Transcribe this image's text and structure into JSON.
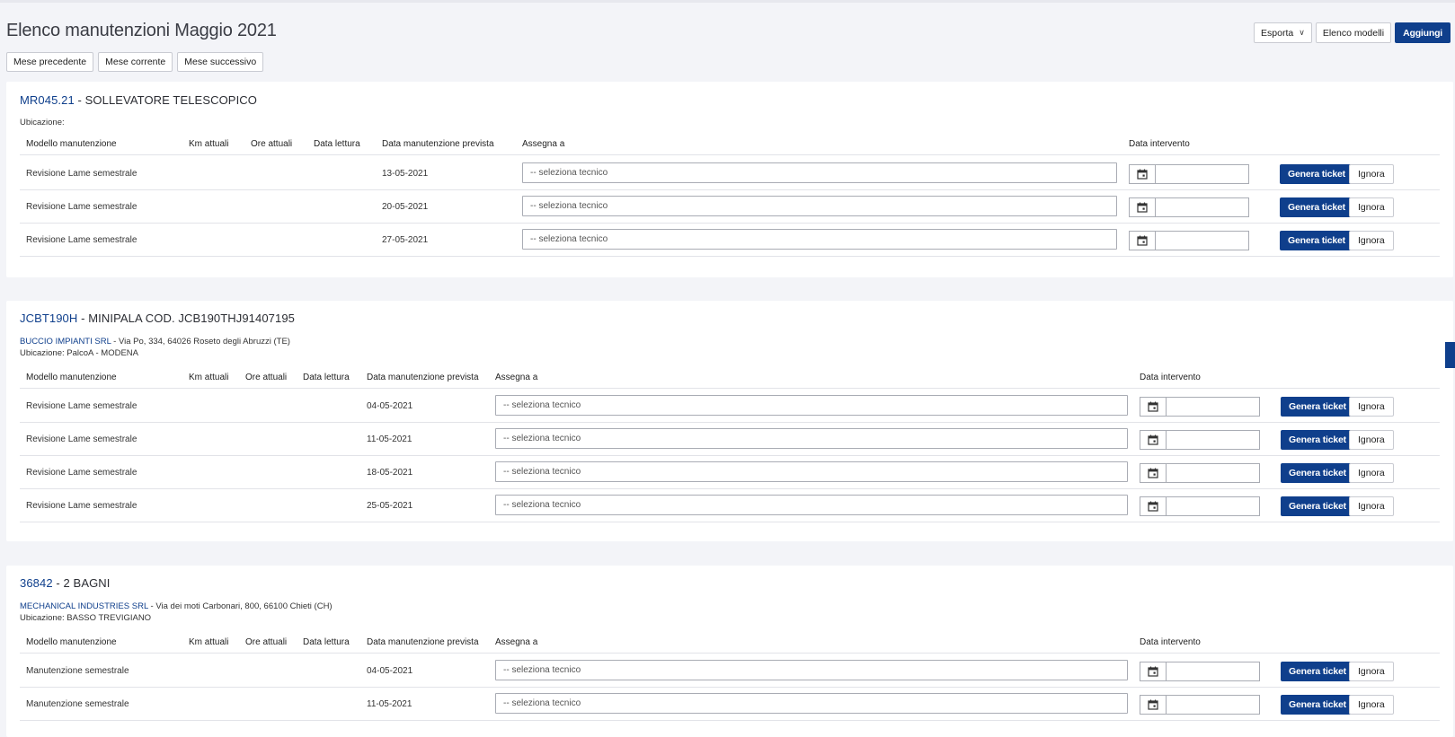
{
  "page": {
    "title": "Elenco manutenzioni Maggio 2021",
    "month_nav": [
      "Mese precedente",
      "Mese corrente",
      "Mese successivo"
    ],
    "actions": {
      "export": "Esporta",
      "models": "Elenco modelli",
      "add": "Aggiungi"
    }
  },
  "columns": {
    "model": "Modello manutenzione",
    "km": "Km attuali",
    "hours": "Ore attuali",
    "reading_date": "Data lettura",
    "planned_date": "Data manutenzione prevista",
    "assign": "Assegna a",
    "intervention_date": "Data intervento"
  },
  "row_labels": {
    "select_placeholder": "-- seleziona tecnico",
    "generate": "Genera ticket",
    "ignore": "Ignora"
  },
  "cards": [
    {
      "code": "MR045.21",
      "sep": " - ",
      "description": "SOLLEVATORE TELESCOPICO",
      "customer": "",
      "address": "",
      "location": "Ubicazione:",
      "rows": [
        {
          "model": "Revisione Lame semestrale",
          "date": "13-05-2021"
        },
        {
          "model": "Revisione Lame semestrale",
          "date": "20-05-2021"
        },
        {
          "model": "Revisione Lame semestrale",
          "date": "27-05-2021"
        }
      ]
    },
    {
      "code": "JCBT190H",
      "sep": " - ",
      "description": "MINIPALA COD. JCB190THJ91407195",
      "customer": "BUCCIO IMPIANTI SRL",
      "address": " - Via Po, 334, 64026 Roseto degli Abruzzi (TE)",
      "location": "Ubicazione: PalcoA - MODENA",
      "rows": [
        {
          "model": "Revisione Lame semestrale",
          "date": "04-05-2021"
        },
        {
          "model": "Revisione Lame semestrale",
          "date": "11-05-2021"
        },
        {
          "model": "Revisione Lame semestrale",
          "date": "18-05-2021"
        },
        {
          "model": "Revisione Lame semestrale",
          "date": "25-05-2021"
        }
      ]
    },
    {
      "code": "36842",
      "sep": " - ",
      "description": "2 BAGNI",
      "customer": "MECHANICAL INDUSTRIES SRL",
      "address": " - Via dei moti Carbonari, 800, 66100 Chieti (CH)",
      "location": "Ubicazione: BASSO TREVIGIANO",
      "rows": [
        {
          "model": "Manutenzione semestrale",
          "date": "04-05-2021"
        },
        {
          "model": "Manutenzione semestrale",
          "date": "11-05-2021"
        }
      ]
    }
  ]
}
